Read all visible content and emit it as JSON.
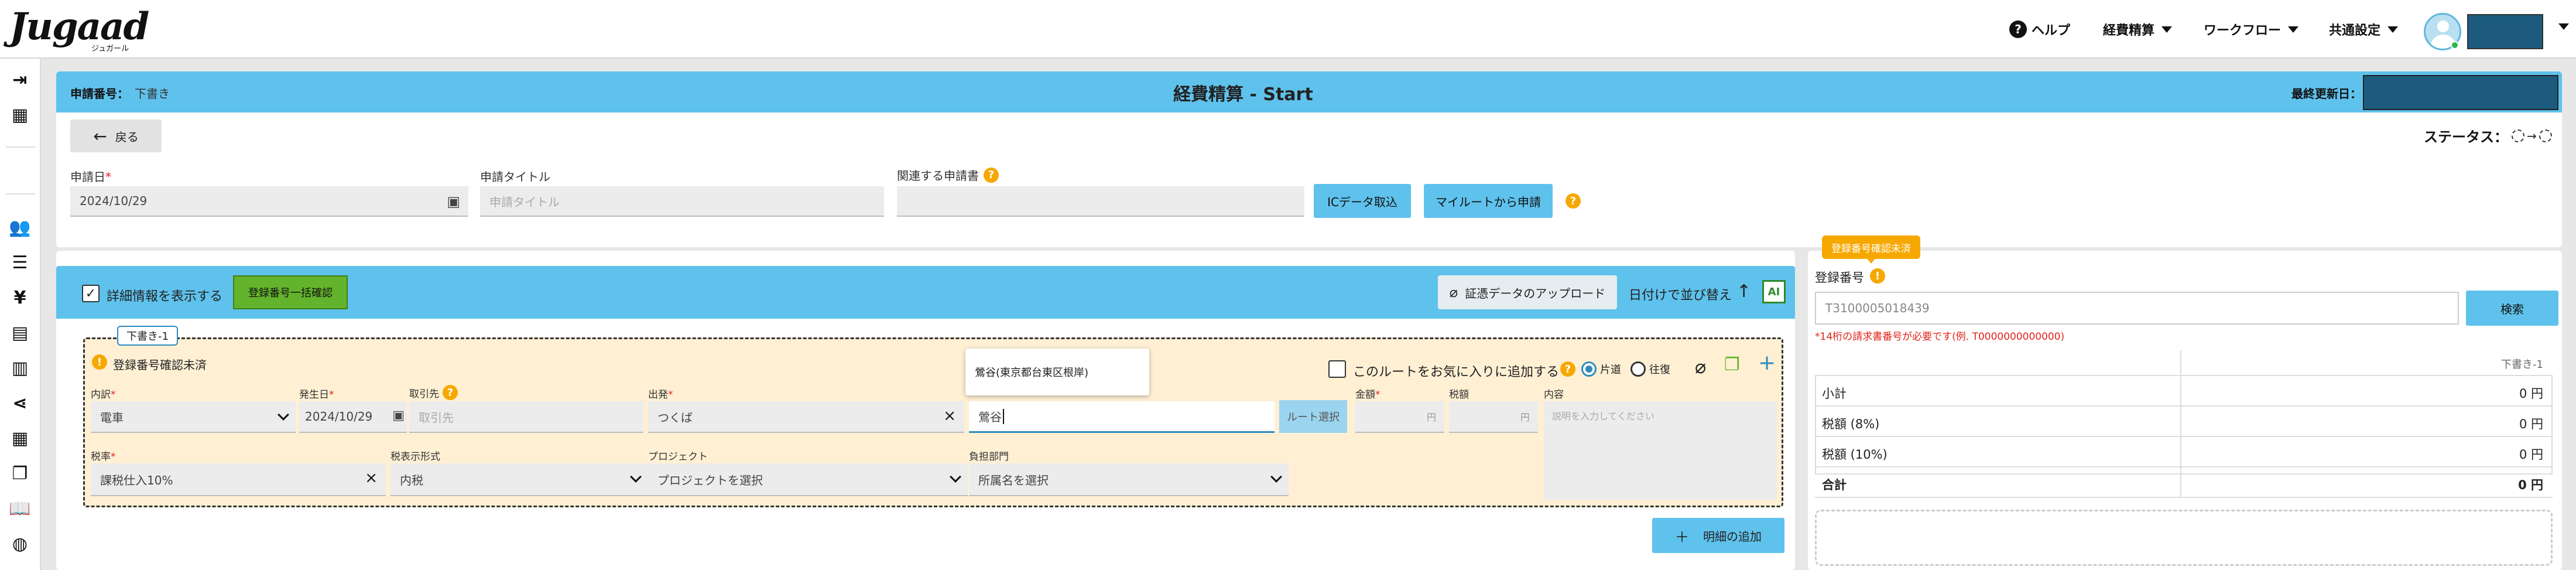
{
  "app": {
    "logo": "Jugaad",
    "logo_sub": "ジュガール"
  },
  "header": {
    "help": "ヘルプ",
    "menu": [
      "経費精算",
      "ワークフロー",
      "共通設定"
    ]
  },
  "form_header": {
    "app_no_label": "申請番号：",
    "app_no_value": "下書き",
    "title": "経費精算 - Start",
    "last_updated_label": "最終更新日："
  },
  "back_button": "戻る",
  "status_label": "ステータス：",
  "fields": {
    "date_label": "申請日",
    "date_value": "2024/10/29",
    "title_label": "申請タイトル",
    "title_placeholder": "申請タイトル",
    "related_label": "関連する申請書",
    "ic_button": "ICデータ取込",
    "myroute_button": "マイルートから申請"
  },
  "detail_toolbar": {
    "show_detail": "詳細情報を表示する",
    "bulk_confirm": "登録番号一括確認",
    "upload": "証憑データのアップロード",
    "sort": "日付けで並び替え",
    "sort_arrow": "↑",
    "ai": "AI"
  },
  "detail": {
    "chip": "下書き-1",
    "warning": "登録番号確認未済",
    "favorite": "このルートをお気に入りに追加する",
    "one_way": "片道",
    "round_trip": "往復",
    "labels": {
      "type": "内訳",
      "date": "発生日",
      "vendor": "取引先",
      "from": "出発",
      "amount": "金額",
      "tax": "税額",
      "content": "内容",
      "tax_rate": "税率",
      "tax_display": "税表示形式",
      "project": "プロジェクト",
      "department": "負担部門"
    },
    "values": {
      "type": "電車",
      "date": "2024/10/29",
      "vendor_ph": "取引先",
      "from": "つくば",
      "to": "鶯谷",
      "suggestion": "鶯谷(東京都台東区根岸)",
      "route_btn": "ルート選択",
      "yen": "円",
      "content_ph": "説明を入力してください",
      "tax_rate": "課税仕入10%",
      "tax_display": "内税",
      "project_ph": "プロジェクトを選択",
      "department_ph": "所属名を選択"
    },
    "add_detail": "明細の追加",
    "add_plus": "＋"
  },
  "panel": {
    "tooltip": "登録番号確認未済",
    "reg_label": "登録番号",
    "reg_value": "T3100005018439",
    "search": "検索",
    "hint": "*14桁の請求書番号が必要です(例. T0000000000000)",
    "col_header": "下書き-1",
    "rows": [
      {
        "label": "小計",
        "value": "0 円"
      },
      {
        "label": "税額 (8%)",
        "value": "0 円"
      },
      {
        "label": "税額 (10%)",
        "value": "0 円"
      },
      {
        "label": "合計",
        "value": "0 円"
      }
    ]
  },
  "colors": {
    "brand_blue": "#5fc2ec",
    "detail_bg": "#fff0d4",
    "warning": "#f7a800",
    "green": "#64b32c"
  }
}
